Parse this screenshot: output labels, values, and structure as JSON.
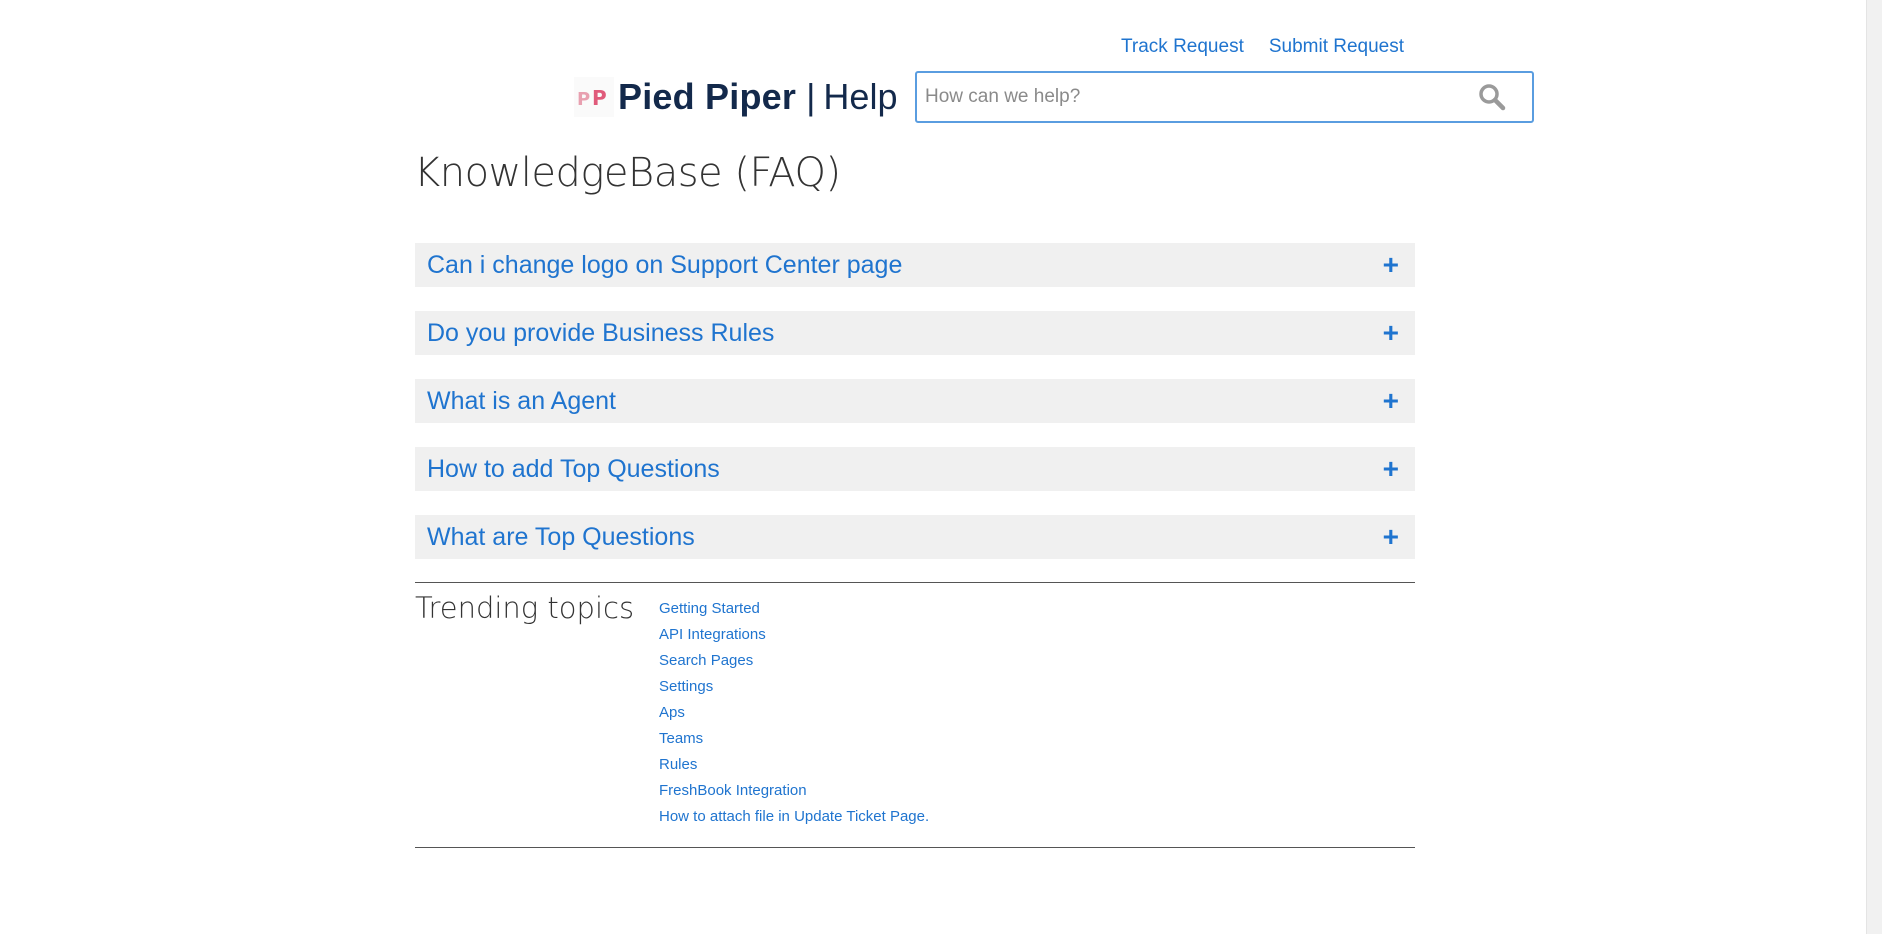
{
  "header": {
    "track_request": "Track Request",
    "submit_request": "Submit Request",
    "brand_name": "Pied Piper",
    "brand_separator": "|",
    "brand_help": "Help",
    "logo_icon": "pp-logo-icon"
  },
  "search": {
    "placeholder": "How can we help?",
    "value": "",
    "icon": "search-icon"
  },
  "page_title": "KnowledgeBase (FAQ)",
  "faq": {
    "items": [
      {
        "question": "Can i change logo on Support Center page",
        "expand_symbol": "+"
      },
      {
        "question": "Do you provide Business Rules",
        "expand_symbol": "+"
      },
      {
        "question": "What is an Agent",
        "expand_symbol": "+"
      },
      {
        "question": "How to add Top Questions",
        "expand_symbol": "+"
      },
      {
        "question": "What are Top Questions",
        "expand_symbol": "+"
      }
    ]
  },
  "trending": {
    "title": "Trending topics",
    "topics": [
      "Getting Started",
      "API Integrations",
      "Search Pages",
      "Settings",
      "Aps",
      "Teams",
      "Rules",
      "FreshBook Integration",
      "How to attach file in Update Ticket Page."
    ]
  },
  "colors": {
    "link": "#1f74cf",
    "brand": "#13294b",
    "faq_bg": "#f0f0f0",
    "search_border": "#5a9de0"
  }
}
